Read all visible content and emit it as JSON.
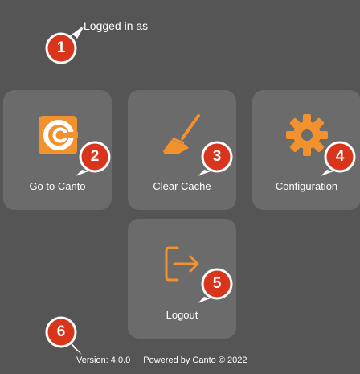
{
  "header": {
    "logged_in_label": "Logged in as"
  },
  "tiles": [
    {
      "label": "Go to Canto",
      "icon": "canto-logo-icon"
    },
    {
      "label": "Clear Cache",
      "icon": "broom-icon"
    },
    {
      "label": "Configuration",
      "icon": "gear-icon"
    },
    {
      "label": "Logout",
      "icon": "logout-icon"
    }
  ],
  "callouts": [
    "1",
    "2",
    "3",
    "4",
    "5",
    "6"
  ],
  "footer": {
    "version": "Version: 4.0.0",
    "powered_by": "Powered by Canto © 2022"
  },
  "colors": {
    "background": "#555555",
    "tile": "#6b6b6b",
    "accent": "#f2922e",
    "callout_red": "#d9341c"
  }
}
